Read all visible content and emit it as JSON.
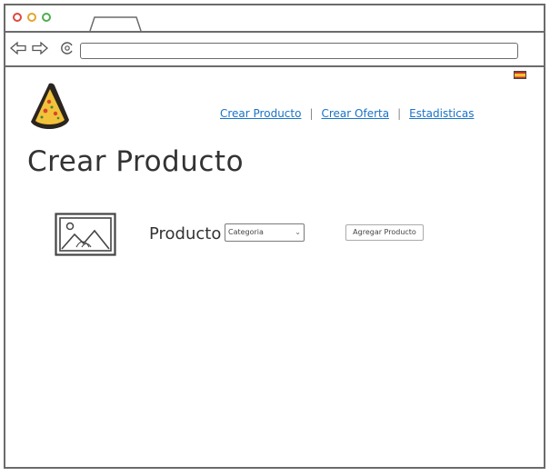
{
  "browser": {
    "url": "",
    "colors": {
      "close": "#e0473e",
      "minimize": "#e3a52b",
      "maximize": "#4cae4c",
      "frame": "#6b6b6b"
    }
  },
  "header": {
    "language_flag": "flag-spain-icon",
    "logo": "pizza-slice-logo",
    "nav": [
      {
        "label": "Crear Producto"
      },
      {
        "label": "Crear Oferta"
      },
      {
        "label": "Estadisticas"
      }
    ],
    "link_color": "#1a73c8"
  },
  "main": {
    "title": "Crear Producto",
    "form": {
      "image_icon": "image-placeholder-icon",
      "product_label": "Producto",
      "category_select": {
        "value": "Categoria"
      },
      "add_button": "Agregar Producto"
    }
  }
}
